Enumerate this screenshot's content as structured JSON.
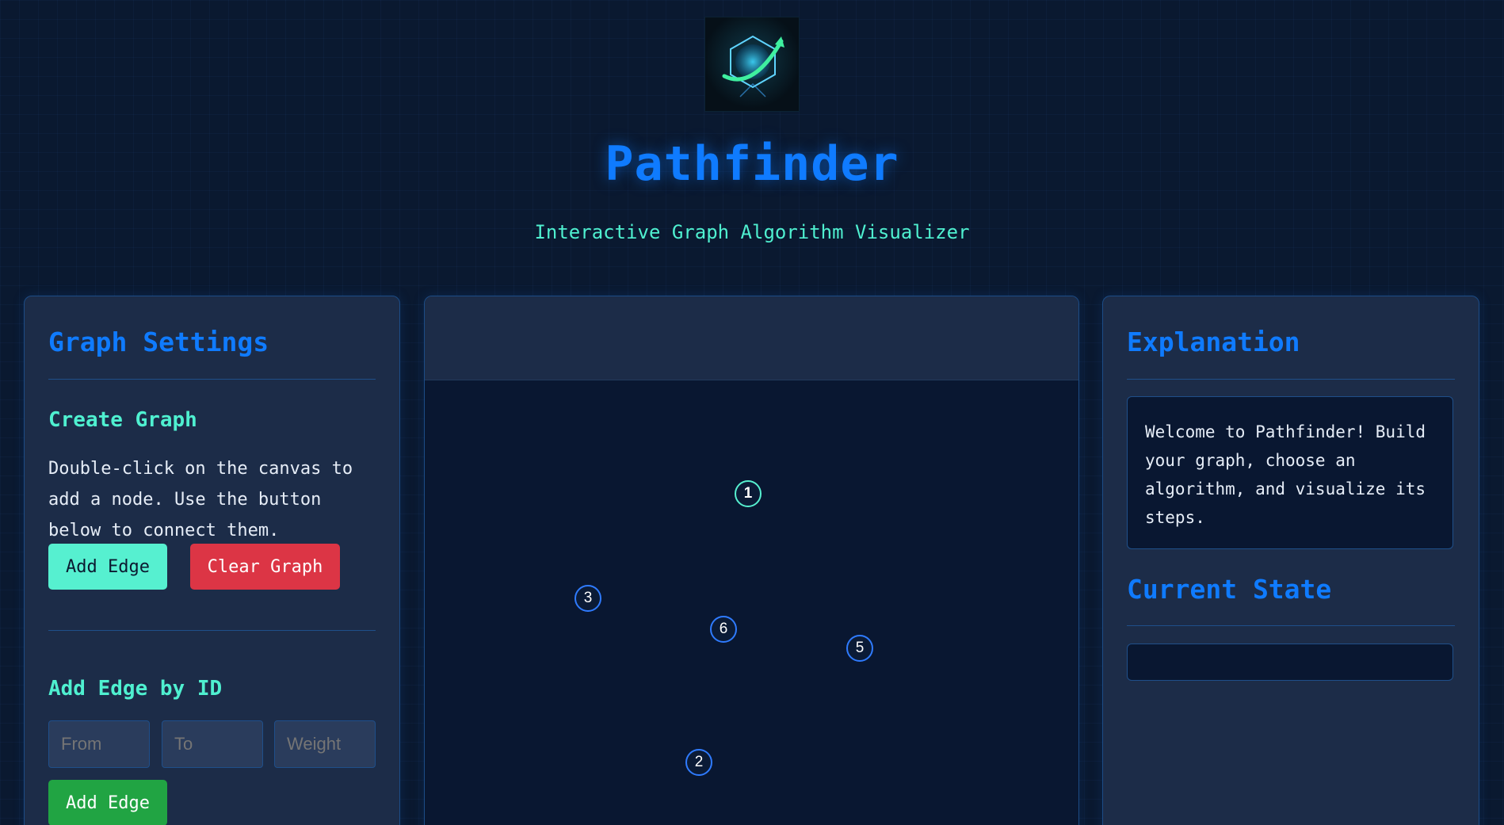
{
  "header": {
    "title": "Pathfinder",
    "subtitle": "Interactive Graph Algorithm Visualizer",
    "logo_icon": "globe-arrow-logo"
  },
  "left_panel": {
    "title": "Graph Settings",
    "create_graph": {
      "heading": "Create Graph",
      "description": "Double-click on the canvas to add a node. Use the button below to connect them.",
      "add_edge_label": "Add Edge",
      "clear_graph_label": "Clear Graph"
    },
    "add_edge_by_id": {
      "heading": "Add Edge by ID",
      "from_placeholder": "From",
      "to_placeholder": "To",
      "weight_placeholder": "Weight",
      "submit_label": "Add Edge"
    }
  },
  "canvas": {
    "nodes": [
      {
        "label": "1",
        "start": true
      },
      {
        "label": "3",
        "start": false
      },
      {
        "label": "6",
        "start": false
      },
      {
        "label": "5",
        "start": false
      },
      {
        "label": "2",
        "start": false
      }
    ]
  },
  "right_panel": {
    "explanation_title": "Explanation",
    "explanation_text": "Welcome to Pathfinder! Build your graph, choose an algorithm, and visualize its steps.",
    "state_title": "Current State",
    "state_text": ""
  },
  "colors": {
    "accent": "#0f7bff",
    "teal": "#56f0d0",
    "danger": "#dc3545",
    "success": "#21a443",
    "background": "#0a1930"
  }
}
